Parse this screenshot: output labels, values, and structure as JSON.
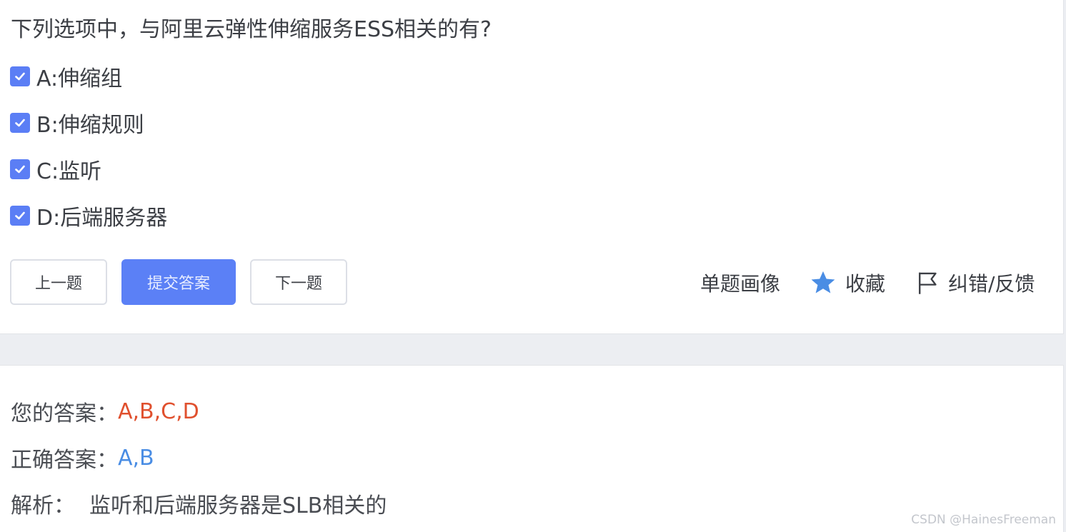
{
  "question": {
    "text": "下列选项中，与阿里云弹性伸缩服务ESS相关的有?",
    "options": [
      {
        "label": "A:伸缩组",
        "checked": true
      },
      {
        "label": "B:伸缩规则",
        "checked": true
      },
      {
        "label": "C:监听",
        "checked": true
      },
      {
        "label": "D:后端服务器",
        "checked": true
      }
    ]
  },
  "buttons": {
    "prev": "上一题",
    "submit": "提交答案",
    "next": "下一题"
  },
  "actions": {
    "portrait": "单题画像",
    "favorite": "收藏",
    "feedback": "纠错/反馈"
  },
  "result": {
    "your_answer_label": "您的答案：",
    "your_answer_value": "A,B,C,D",
    "correct_answer_label": "正确答案：",
    "correct_answer_value": "A,B",
    "analysis_label": "解析：",
    "analysis_text": "监听和后端服务器是SLB相关的"
  },
  "watermark": "CSDN @HainesFreeman",
  "colors": {
    "accent": "#5b80f6",
    "checkbox": "#5b7ef5",
    "wrong": "#e0502e",
    "correct": "#4a8de4",
    "star": "#4a8de4"
  },
  "icons": {
    "checkbox": "check-icon",
    "favorite": "star-icon",
    "feedback": "flag-icon"
  }
}
